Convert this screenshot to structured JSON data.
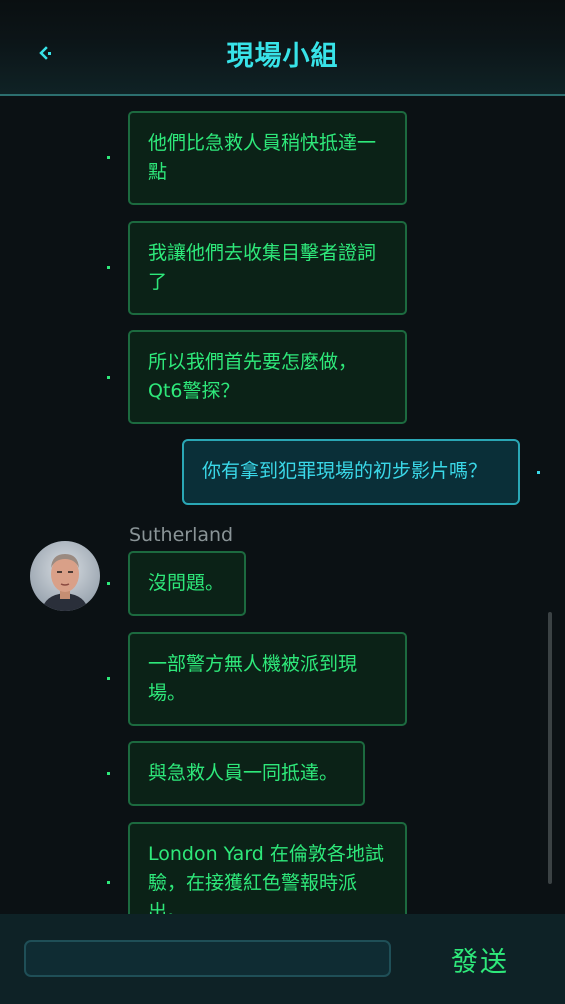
{
  "header": {
    "title": "現場小組",
    "back_icon": "chevron-left-icon"
  },
  "messages": [
    {
      "direction": "received",
      "text": "他們比急救人員稍快抵達一點"
    },
    {
      "direction": "received",
      "text": "我讓他們去收集目擊者證詞了"
    },
    {
      "direction": "received",
      "text": "所以我們首先要怎麼做，Qt6警探？"
    },
    {
      "direction": "sent",
      "text": "你有拿到犯罪現場的初步影片嗎？"
    },
    {
      "direction": "received",
      "sender": "Sutherland",
      "text": "沒問題。"
    },
    {
      "direction": "received",
      "text": "一部警方無人機被派到現場。"
    },
    {
      "direction": "received",
      "text": "與急救人員一同抵達。"
    },
    {
      "direction": "received",
      "text": "London Yard 在倫敦各地試驗，在接獲紅色警報時派出。"
    }
  ],
  "composer": {
    "input_value": "",
    "send_label": "發送"
  },
  "colors": {
    "accent_cyan": "#38e3e8",
    "received_text": "#2ee87a",
    "received_border": "#1c6a3f",
    "sent_border": "#2aa7b5",
    "background": "#0b1114"
  }
}
